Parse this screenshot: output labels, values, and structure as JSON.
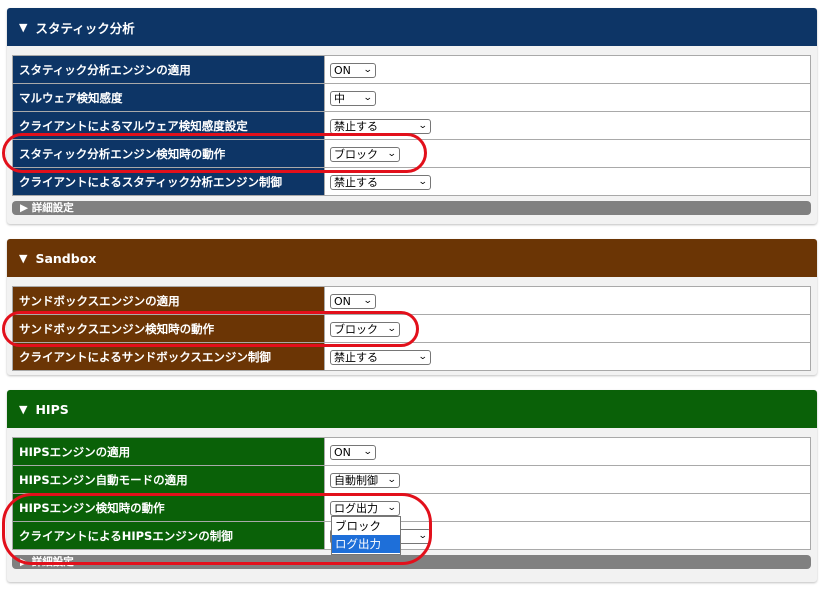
{
  "static": {
    "title": "スタティック分析",
    "rows": [
      {
        "label": "スタティック分析エンジンの適用",
        "value": "ON"
      },
      {
        "label": "マルウェア検知感度",
        "value": "中"
      },
      {
        "label": "クライアントによるマルウェア検知感度設定",
        "value": "禁止する"
      },
      {
        "label": "スタティック分析エンジン検知時の動作",
        "value": "ブロック"
      },
      {
        "label": "クライアントによるスタティック分析エンジン制御",
        "value": "禁止する"
      }
    ],
    "detail": "詳細設定"
  },
  "sandbox": {
    "title": "Sandbox",
    "rows": [
      {
        "label": "サンドボックスエンジンの適用",
        "value": "ON"
      },
      {
        "label": "サンドボックスエンジン検知時の動作",
        "value": "ブロック"
      },
      {
        "label": "クライアントによるサンドボックスエンジン制御",
        "value": "禁止する"
      }
    ]
  },
  "hips": {
    "title": "HIPS",
    "rows": [
      {
        "label": "HIPSエンジンの適用",
        "value": "ON"
      },
      {
        "label": "HIPSエンジン自動モードの適用",
        "value": "自動制御"
      },
      {
        "label": "HIPSエンジン検知時の動作",
        "value": "ログ出力"
      },
      {
        "label": "クライアントによるHIPSエンジンの制御",
        "value": ""
      }
    ],
    "detail": "詳細設定",
    "dropdown_options": [
      "ブロック",
      "ログ出力"
    ],
    "dropdown_highlighted": "ログ出力"
  },
  "icons": {
    "collapse": "▼",
    "expand": "▶",
    "select": "⌄"
  },
  "colors": {
    "static_header": "#0d3566",
    "sandbox_header": "#6b3505",
    "hips_header": "#0a6108",
    "highlight_oval": "#e2101b",
    "dropdown_selected": "#1e6fd9"
  }
}
